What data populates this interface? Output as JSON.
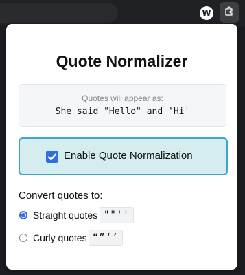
{
  "browser": {
    "profile_initial": "W",
    "icons": [
      "profile-avatar-icon",
      "extensions-puzzle-icon"
    ]
  },
  "popup": {
    "title": "Quote Normalizer",
    "preview": {
      "label": "Quotes will appear as:",
      "text": "She said \"Hello\" and 'Hi'"
    },
    "toggle": {
      "label": "Enable Quote Normalization",
      "checked": true
    },
    "convert_label": "Convert quotes to:",
    "options": [
      {
        "label": "Straight quotes",
        "sample": "\"\"''",
        "selected": true
      },
      {
        "label": "Curly quotes",
        "sample": "“”‘’",
        "selected": false
      }
    ]
  },
  "colors": {
    "accent": "#2d6fdd",
    "toggle_bg": "#d6edf0",
    "toggle_border": "#3aa6c8"
  }
}
